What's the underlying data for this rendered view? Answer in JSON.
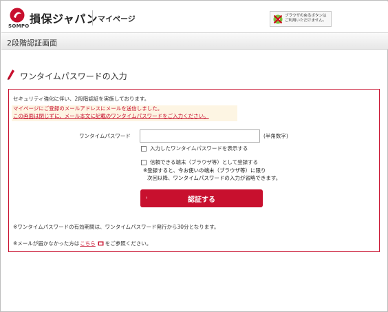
{
  "header": {
    "brand": "損保ジャパン",
    "brand_sub": "SOMPO",
    "mypage": "マイページ",
    "browser_notice_line1": "ブラウザの戻るボタンは",
    "browser_notice_line2": "ご利用いただけません。"
  },
  "titlebar": {
    "title": "2段階認証画面"
  },
  "section": {
    "title": "ワンタイムパスワードの入力"
  },
  "form": {
    "intro": "セキュリティ強化に伴い、2段階認証を実施しております。",
    "alert_line1": "マイページにご登録のメールアドレスにメールを送信しました。",
    "alert_line2": "この画面は閉じずに、メール本文に記載のワンタイムパスワードをご入力ください。",
    "otp_label": "ワンタイムパスワード",
    "otp_value": "",
    "otp_hint": "(半角数字)",
    "show_password_label": "入力したワンタイムパスワードを表示する",
    "trust_device_label": "信頼できる端末（ブラウザ等）として登録する",
    "trust_note1": "※登録すると、今お使いの端末（ブラウザ等）に限り",
    "trust_note2": "次回以降、ワンタイムパスワードの入力が省略できます。",
    "submit_arrow": "›",
    "submit_label": "認証する",
    "note_validity": "※ワンタイムパスワードの有効期間は、ワンタイムパスワード発行から30分となります。",
    "note_mail_prefix": "※メールが届かなかった方は",
    "note_mail_link": "こちら",
    "note_mail_suffix": "をご参照ください。"
  },
  "colors": {
    "brand_red": "#c8102e",
    "alert_bg": "#fdf5e3"
  },
  "icons": {
    "logo": "sompo-logo-icon",
    "no_back": "no-back-button-icon",
    "pencil": "pencil-icon",
    "external": "external-window-icon"
  }
}
